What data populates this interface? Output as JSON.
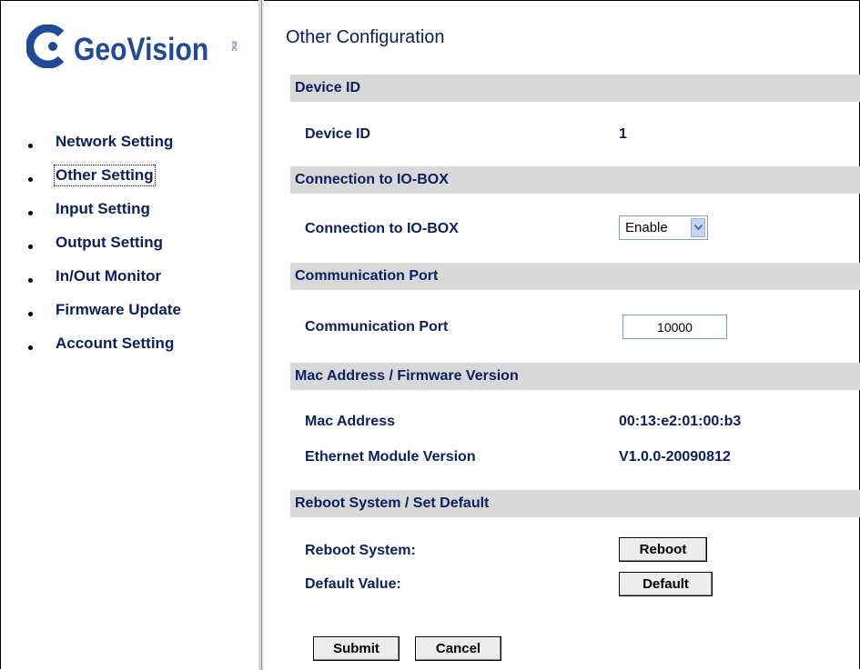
{
  "brand": {
    "name": "GeoVision",
    "suffix": "inc",
    "color": "#1f4a9c"
  },
  "sidebar": {
    "items": [
      {
        "label": "Network Setting",
        "active": false
      },
      {
        "label": "Other Setting",
        "active": true
      },
      {
        "label": "Input Setting",
        "active": false
      },
      {
        "label": "Output Setting",
        "active": false
      },
      {
        "label": "In/Out Monitor",
        "active": false
      },
      {
        "label": "Firmware Update",
        "active": false
      },
      {
        "label": "Account Setting",
        "active": false
      }
    ]
  },
  "main": {
    "title": "Other Configuration",
    "sections": {
      "device_id": {
        "header": "Device ID",
        "label": "Device ID",
        "value": "1"
      },
      "io_box": {
        "header": "Connection to IO-BOX",
        "label": "Connection to IO-BOX",
        "selected": "Enable"
      },
      "comm_port": {
        "header": "Communication Port",
        "label": "Communication Port",
        "value": "10000"
      },
      "mac_fw": {
        "header": "Mac Address / Firmware Version",
        "mac_label": "Mac Address",
        "mac_value": "00:13:e2:01:00:b3",
        "fw_label": "Ethernet Module Version",
        "fw_value": "V1.0.0-20090812"
      },
      "reboot": {
        "header": "Reboot System / Set Default",
        "reboot_label": "Reboot System:",
        "reboot_button": "Reboot",
        "default_label": "Default Value:",
        "default_button": "Default"
      }
    },
    "submit_button": "Submit",
    "cancel_button": "Cancel"
  },
  "colors": {
    "text": "#0a1e63",
    "section_bg": "#d8d8d8"
  }
}
